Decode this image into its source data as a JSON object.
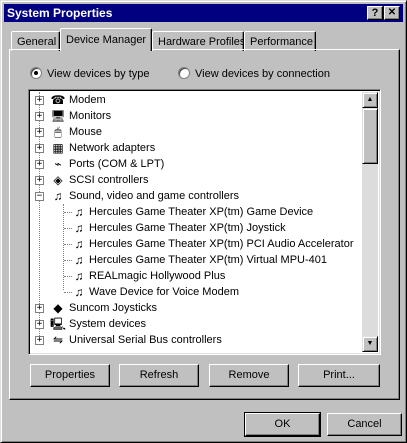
{
  "window": {
    "title": "System Properties",
    "help_glyph": "?",
    "close_glyph": "✕"
  },
  "tabs": [
    {
      "label": "General",
      "active": false
    },
    {
      "label": "Device Manager",
      "active": true
    },
    {
      "label": "Hardware Profiles",
      "active": false
    },
    {
      "label": "Performance",
      "active": false
    }
  ],
  "view_options": {
    "by_type": {
      "label": "View devices by type",
      "selected": true
    },
    "by_connection": {
      "label": "View devices by connection",
      "selected": false
    }
  },
  "tree": {
    "items": [
      {
        "label": "Modem",
        "icon": "modem-icon",
        "glyph": "☎"
      },
      {
        "label": "Monitors",
        "icon": "monitor-icon",
        "glyph": "🖥"
      },
      {
        "label": "Mouse",
        "icon": "mouse-icon",
        "glyph": "🖱"
      },
      {
        "label": "Network adapters",
        "icon": "network-adapter-icon",
        "glyph": "▦"
      },
      {
        "label": "Ports (COM & LPT)",
        "icon": "port-icon",
        "glyph": "⌁"
      },
      {
        "label": "SCSI controllers",
        "icon": "scsi-icon",
        "glyph": "◈"
      },
      {
        "label": "Sound, video and game controllers",
        "icon": "sound-controller-icon",
        "glyph": "♫"
      },
      {
        "label": "Hercules Game Theater XP(tm) Game Device",
        "icon": "sound-device-icon",
        "glyph": "♫"
      },
      {
        "label": "Hercules Game Theater XP(tm) Joystick",
        "icon": "sound-device-icon",
        "glyph": "♫"
      },
      {
        "label": "Hercules Game Theater XP(tm) PCI Audio Accelerator",
        "icon": "sound-device-icon",
        "glyph": "♫"
      },
      {
        "label": "Hercules Game Theater XP(tm) Virtual MPU-401",
        "icon": "sound-device-icon",
        "glyph": "♫"
      },
      {
        "label": "REALmagic Hollywood Plus",
        "icon": "sound-device-icon",
        "glyph": "♫"
      },
      {
        "label": "Wave Device for Voice Modem",
        "icon": "sound-device-icon",
        "glyph": "♫"
      },
      {
        "label": "Suncom Joysticks",
        "icon": "joystick-icon",
        "glyph": "◆"
      },
      {
        "label": "System devices",
        "icon": "system-device-icon",
        "glyph": "🖳"
      },
      {
        "label": "Universal Serial Bus controllers",
        "icon": "usb-icon",
        "glyph": "⇋"
      }
    ],
    "expand_glyph": "+",
    "collapse_glyph": "−"
  },
  "scrollbar": {
    "up_glyph": "▲",
    "down_glyph": "▼"
  },
  "actions": {
    "properties": "Properties",
    "refresh": "Refresh",
    "remove": "Remove",
    "print": "Print..."
  },
  "footer": {
    "ok": "OK",
    "cancel": "Cancel"
  }
}
